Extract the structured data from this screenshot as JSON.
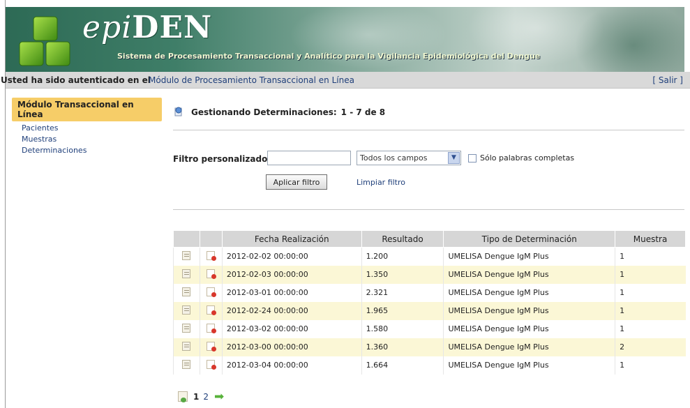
{
  "header": {
    "logo_prefix": "epi",
    "logo_suffix": "DEN",
    "subtitle": "Sistema de Procesamiento Transaccional y Analítico para la Vigilancia Epidemiológica del Dengue"
  },
  "auth_bar": {
    "prefix": "Usted ha sido autenticado en el",
    "module": "Módulo de Procesamiento Transaccional en Línea",
    "logout": "[ Salir ]"
  },
  "sidebar": {
    "title": "Módulo Transaccional en Línea",
    "items": [
      {
        "label": "Pacientes"
      },
      {
        "label": "Muestras"
      },
      {
        "label": "Determinaciones"
      }
    ]
  },
  "main": {
    "title": "Gestionando Determinaciones:",
    "range": "1 - 7 de 8"
  },
  "filter": {
    "label": "Filtro personalizado",
    "input_value": "",
    "select_value": "Todos los campos",
    "checkbox_label": "Sólo palabras completas",
    "apply_label": "Aplicar filtro",
    "clear_label": "Limpiar filtro"
  },
  "table": {
    "columns": [
      "",
      "",
      "Fecha Realización",
      "Resultado",
      "Tipo de Determinación",
      "Muestra"
    ],
    "rows": [
      [
        "2012-02-02 00:00:00",
        "1.200",
        "UMELISA Dengue IgM Plus",
        "1"
      ],
      [
        "2012-02-03 00:00:00",
        "1.350",
        "UMELISA Dengue IgM Plus",
        "1"
      ],
      [
        "2012-03-01 00:00:00",
        "2.321",
        "UMELISA Dengue IgM Plus",
        "1"
      ],
      [
        "2012-02-24 00:00:00",
        "1.965",
        "UMELISA Dengue IgM Plus",
        "1"
      ],
      [
        "2012-03-02 00:00:00",
        "1.580",
        "UMELISA Dengue IgM Plus",
        "1"
      ],
      [
        "2012-03-00 00:00:00",
        "1.360",
        "UMELISA Dengue IgM Plus",
        "2"
      ],
      [
        "2012-03-04 00:00:00",
        "1.664",
        "UMELISA Dengue IgM Plus",
        "1"
      ]
    ]
  },
  "pager": {
    "current": "1",
    "pages": [
      "2"
    ],
    "next_icon": "next-arrow-icon"
  },
  "colors": {
    "sidebar_highlight": "#f6cd68",
    "row_alt": "#fbf7d6",
    "link": "#1f3f7a",
    "header_bar": "#d9d9d9"
  }
}
